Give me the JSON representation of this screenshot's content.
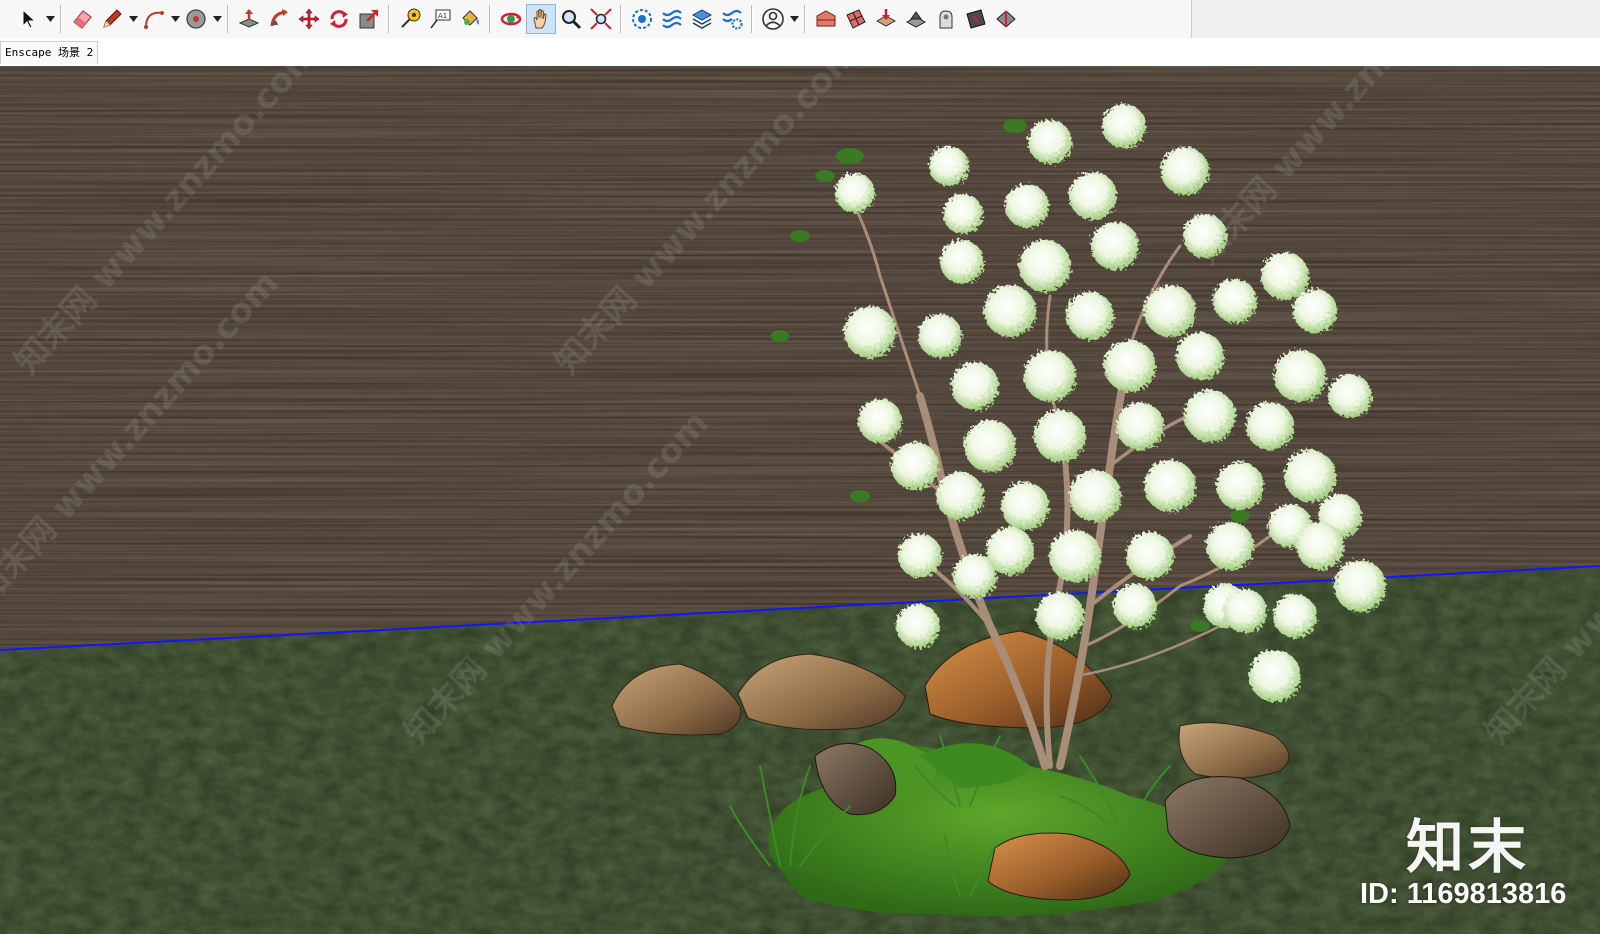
{
  "toolbar": {
    "groups": [
      [
        "select-tool",
        "eraser-tool",
        "line-tool",
        "arc-tool",
        "shapes-tool"
      ],
      [
        "push-pull-tool",
        "follow-me-tool",
        "move-tool",
        "rotate-tool",
        "scale-tool"
      ],
      [
        "tape-measure-tool",
        "text-tool",
        "paint-bucket-tool"
      ],
      [
        "orbit-tool",
        "pan-tool",
        "zoom-tool",
        "zoom-extents-tool"
      ],
      [
        "model-info-tool",
        "section-plane-tool",
        "layers-tool",
        "settings-tool"
      ],
      [
        "account-tool"
      ],
      [
        "3d-warehouse-tool",
        "extension-warehouse-tool",
        "sandbox-tool",
        "walk-tool",
        "look-around-tool",
        "position-camera-tool",
        "top-view-tool"
      ]
    ],
    "active_tool": "pan-tool"
  },
  "tabs": [
    {
      "label": "Enscape 场景 2"
    }
  ],
  "watermark": {
    "brand": "知末",
    "id_text": "ID: 1169813816",
    "diagonal": "知末网 www.znzmo.com"
  },
  "colors": {
    "wall": "#3a3028",
    "ground": "#2e3a22",
    "horizon_line": "#1414ff",
    "moss": "#3f7a1e",
    "blossom": "#eaf4dc"
  }
}
